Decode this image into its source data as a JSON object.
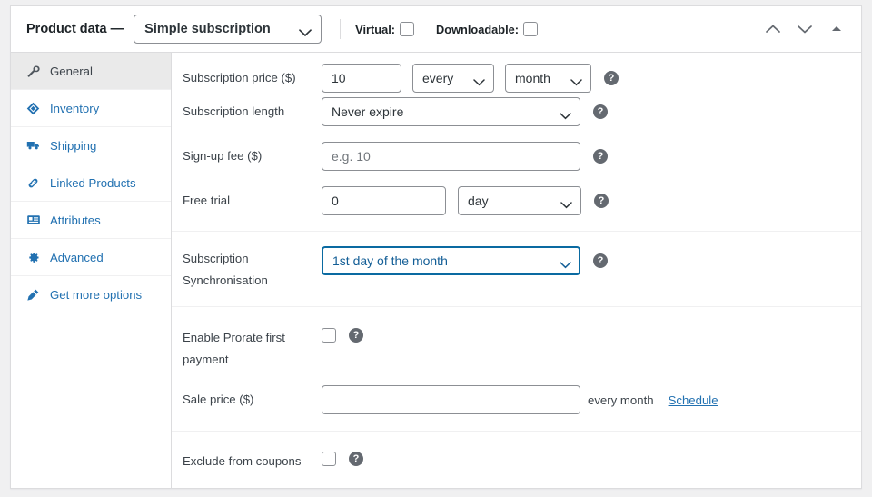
{
  "header": {
    "title": "Product data —",
    "product_type": "Simple subscription",
    "virtual_label": "Virtual:",
    "downloadable_label": "Downloadable:",
    "move_up_icon": "chevron-up-icon",
    "move_down_icon": "chevron-down-icon",
    "collapse_icon": "triangle-up-icon"
  },
  "tabs": [
    {
      "label": "General",
      "icon": "wrench-icon",
      "active": true
    },
    {
      "label": "Inventory",
      "icon": "archive-icon",
      "active": false
    },
    {
      "label": "Shipping",
      "icon": "truck-icon",
      "active": false
    },
    {
      "label": "Linked Products",
      "icon": "link-icon",
      "active": false
    },
    {
      "label": "Attributes",
      "icon": "list-icon",
      "active": false
    },
    {
      "label": "Advanced",
      "icon": "gear-icon",
      "active": false
    },
    {
      "label": "Get more options",
      "icon": "plug-icon",
      "active": false
    }
  ],
  "fields": {
    "subscription_price": {
      "label": "Subscription price ($)",
      "amount": "10",
      "interval": "every",
      "period": "month",
      "help": "?"
    },
    "subscription_length": {
      "label": "Subscription length",
      "value": "Never expire",
      "help": "?"
    },
    "signup_fee": {
      "label": "Sign-up fee ($)",
      "value": "",
      "placeholder": "e.g. 10",
      "help": "?"
    },
    "free_trial": {
      "label": "Free trial",
      "value": "0",
      "period": "day",
      "help": "?"
    },
    "synchronisation": {
      "label": "Subscription Synchronisation",
      "value": "1st day of the month",
      "help": "?",
      "focused": true
    },
    "prorate": {
      "label": "Enable Prorate first payment",
      "checked": false,
      "help": "?"
    },
    "sale_price": {
      "label": "Sale price ($)",
      "value": "",
      "placeholder": "",
      "suffix": "every month",
      "schedule_link": "Schedule"
    },
    "exclude_coupons": {
      "label": "Exclude from coupons",
      "checked": false,
      "help": "?"
    }
  },
  "colors": {
    "link": "#2271b1",
    "focus_border": "#0a6aa1",
    "panel_border": "#dcdcde",
    "active_tab_bg": "#eaeaea"
  }
}
